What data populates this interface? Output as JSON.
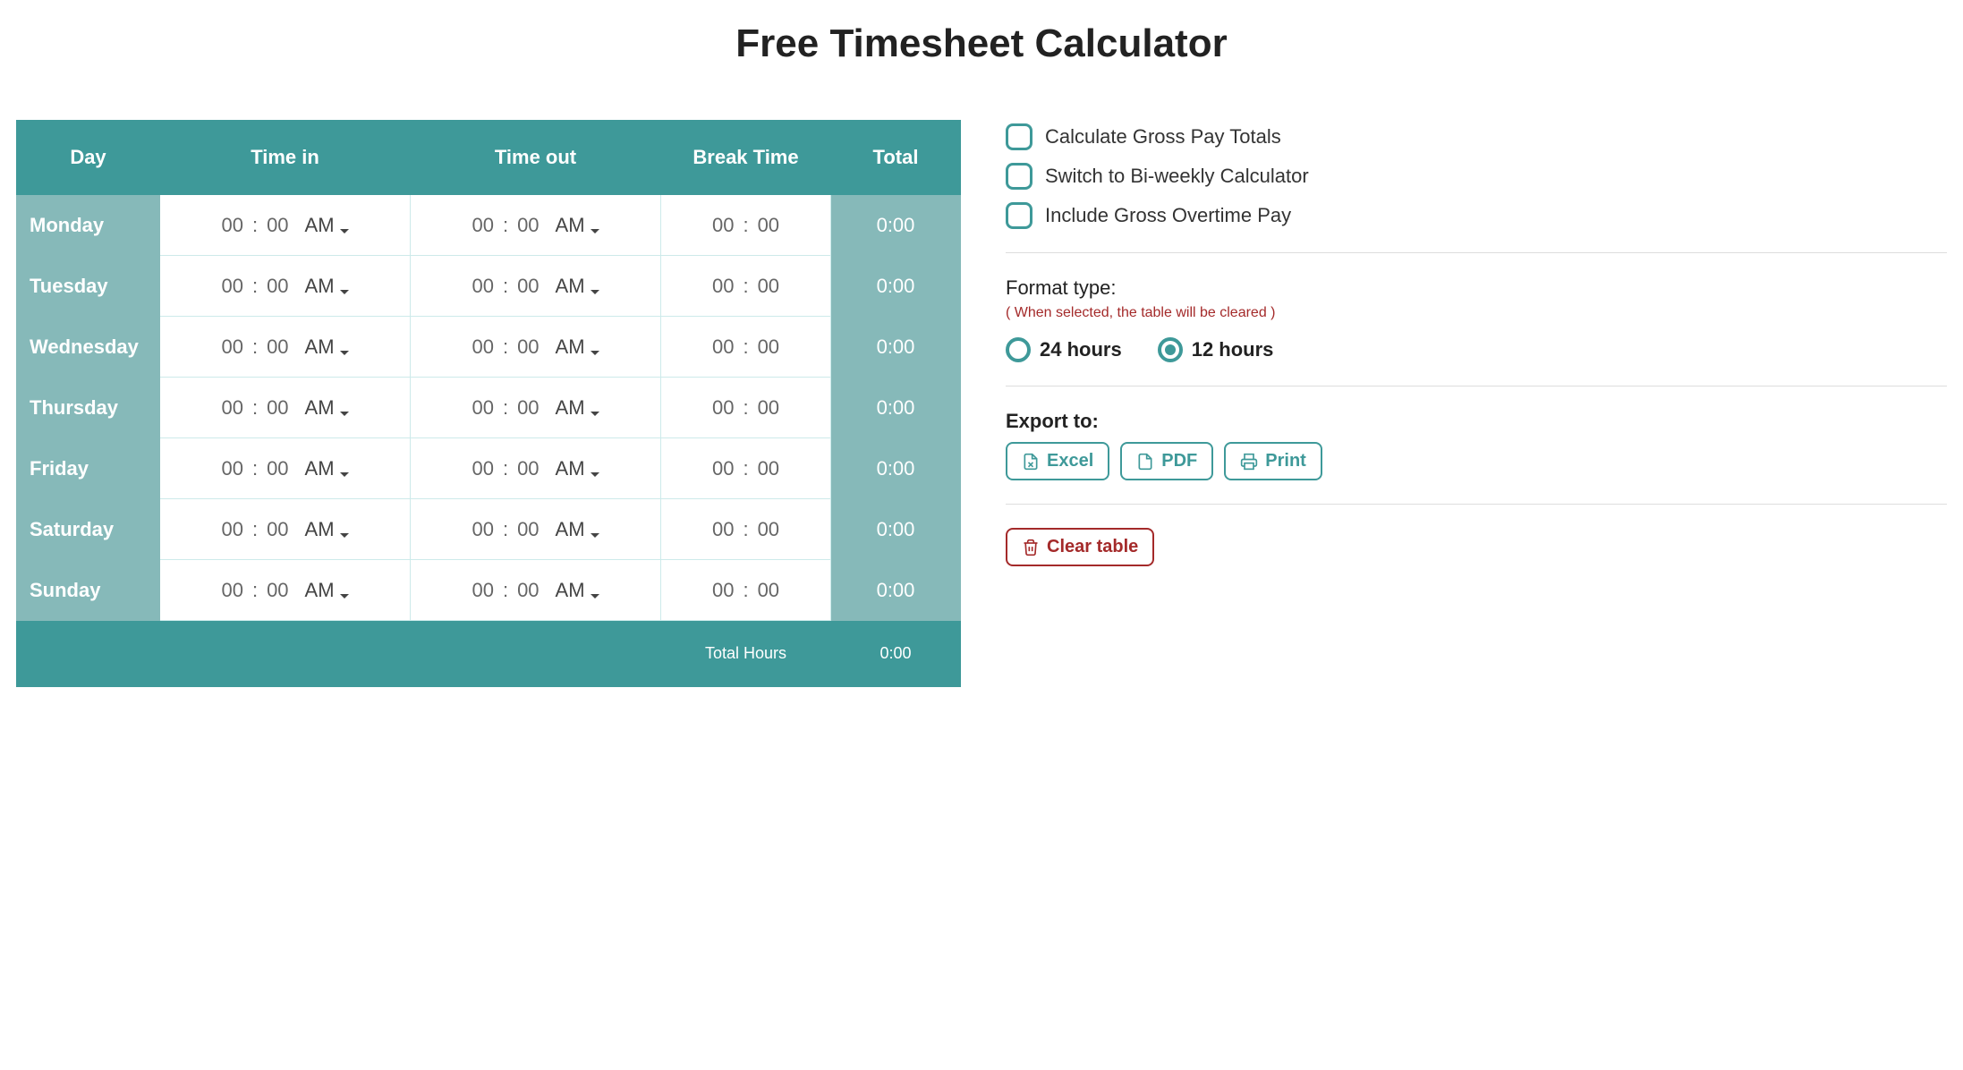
{
  "title": "Free Timesheet Calculator",
  "columns": {
    "day": "Day",
    "time_in": "Time in",
    "time_out": "Time out",
    "break": "Break Time",
    "total": "Total"
  },
  "rows": [
    {
      "day": "Monday",
      "in_h": "00",
      "in_m": "00",
      "in_ap": "AM",
      "out_h": "00",
      "out_m": "00",
      "out_ap": "AM",
      "br_h": "00",
      "br_m": "00",
      "total": "0:00"
    },
    {
      "day": "Tuesday",
      "in_h": "00",
      "in_m": "00",
      "in_ap": "AM",
      "out_h": "00",
      "out_m": "00",
      "out_ap": "AM",
      "br_h": "00",
      "br_m": "00",
      "total": "0:00"
    },
    {
      "day": "Wednesday",
      "in_h": "00",
      "in_m": "00",
      "in_ap": "AM",
      "out_h": "00",
      "out_m": "00",
      "out_ap": "AM",
      "br_h": "00",
      "br_m": "00",
      "total": "0:00"
    },
    {
      "day": "Thursday",
      "in_h": "00",
      "in_m": "00",
      "in_ap": "AM",
      "out_h": "00",
      "out_m": "00",
      "out_ap": "AM",
      "br_h": "00",
      "br_m": "00",
      "total": "0:00"
    },
    {
      "day": "Friday",
      "in_h": "00",
      "in_m": "00",
      "in_ap": "AM",
      "out_h": "00",
      "out_m": "00",
      "out_ap": "AM",
      "br_h": "00",
      "br_m": "00",
      "total": "0:00"
    },
    {
      "day": "Saturday",
      "in_h": "00",
      "in_m": "00",
      "in_ap": "AM",
      "out_h": "00",
      "out_m": "00",
      "out_ap": "AM",
      "br_h": "00",
      "br_m": "00",
      "total": "0:00"
    },
    {
      "day": "Sunday",
      "in_h": "00",
      "in_m": "00",
      "in_ap": "AM",
      "out_h": "00",
      "out_m": "00",
      "out_ap": "AM",
      "br_h": "00",
      "br_m": "00",
      "total": "0:00"
    }
  ],
  "footer": {
    "label": "Total Hours",
    "value": "0:00"
  },
  "options": {
    "gross_pay": "Calculate Gross Pay Totals",
    "biweekly": "Switch to Bi-weekly Calculator",
    "overtime": "Include Gross Overtime Pay"
  },
  "format": {
    "label": "Format type:",
    "warning": "( When selected, the table will be cleared )",
    "opt_24": "24 hours",
    "opt_12": "12 hours",
    "selected": "12"
  },
  "export": {
    "label": "Export to:",
    "excel": "Excel",
    "pdf": "PDF",
    "print": "Print"
  },
  "clear_table": "Clear table",
  "colon": ":",
  "colors": {
    "teal": "#3e9999",
    "teal_light": "#86b9b9",
    "red": "#a42a2a"
  }
}
